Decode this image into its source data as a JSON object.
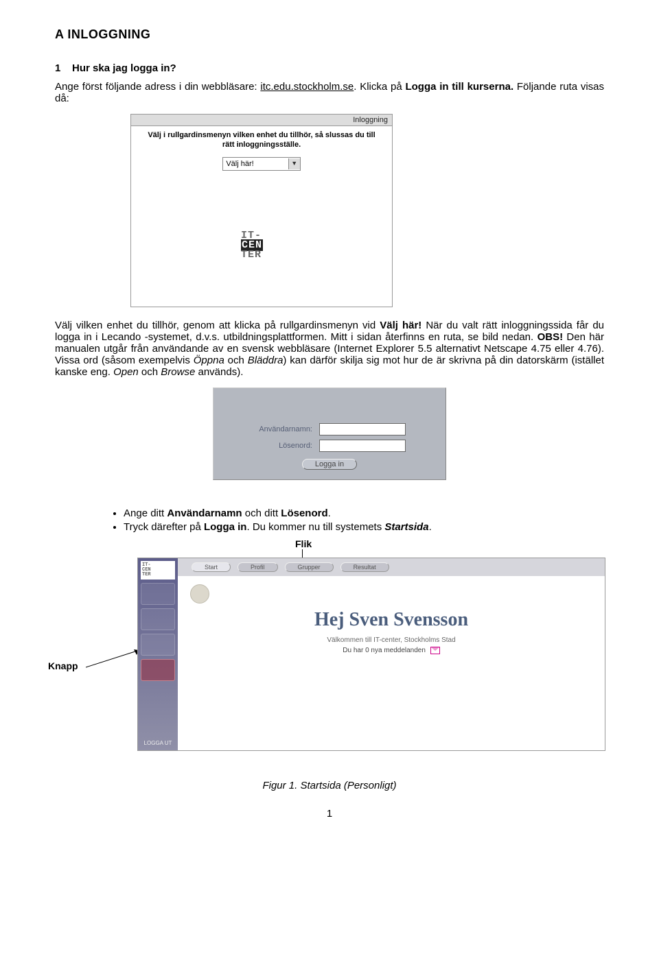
{
  "heading": "A   INLOGGNING",
  "q_number": "1",
  "q_text": "Hur ska jag logga in?",
  "para1_pre": "Ange först följande adress i din webbläsare: ",
  "url": "itc.edu.stockholm.se",
  "para1_mid": ". Klicka på ",
  "para1_link": "Logga in till kurserna.",
  "para1_after": " Följande ruta visas då:",
  "inlog": {
    "header": "Inloggning",
    "instr": "Välj i rullgardinsmenyn vilken enhet du tillhör, så slussas du till rätt inloggningsställe.",
    "select": "Välj här!"
  },
  "para2_a": "Välj vilken enhet du tillhör, genom att klicka på rullgardinsmenyn vid ",
  "para2_valj": "Välj här!",
  "para2_b": " När du valt rätt inloggningssida får du logga in i Lecando -systemet, d.v.s. utbildningsplattformen. Mitt i sidan återfinns en ruta, se bild nedan. ",
  "para2_obs": "OBS!",
  "para2_c": " Den här manualen utgår från användande av en svensk webbläsare (Internet Explorer 5.5 alternativt Netscape 4.75 eller 4.76). Vissa ord (såsom exempelvis ",
  "para2_oppna": "Öppna",
  "para2_and": " och ",
  "para2_bladdra": "Bläddra",
  "para2_d": ") kan därför skilja sig mot hur de är skrivna på din datorskärm (istället kanske eng. ",
  "para2_open": "Open",
  "para2_and2": " och ",
  "para2_browse": "Browse",
  "para2_end": " används).",
  "login": {
    "user_label": "Användarnamn:",
    "pass_label": "Lösenord:",
    "button": "Logga in"
  },
  "bullet1_a": "Ange ditt ",
  "bullet1_user": "Användarnamn",
  "bullet1_mid": " och ditt ",
  "bullet1_pass": "Lösenord",
  "bullet1_end": ".",
  "bullet2_a": "Tryck därefter på ",
  "bullet2_login": "Logga in",
  "bullet2_b": ". Du kommer nu till systemets ",
  "bullet2_start": "Startsida",
  "bullet2_end": ".",
  "flik": "Flik",
  "knapp": "Knapp",
  "start": {
    "tabs": [
      "Start",
      "Profil",
      "Grupper",
      "Resultat"
    ],
    "hello": "Hej Sven Svensson",
    "welcome": "Välkommen till IT-center, Stockholms Stad",
    "msgs": "Du har 0 nya meddelanden",
    "logout": "LOGGA UT"
  },
  "figure": "Figur 1. Startsida (Personligt)",
  "page_number": "1"
}
